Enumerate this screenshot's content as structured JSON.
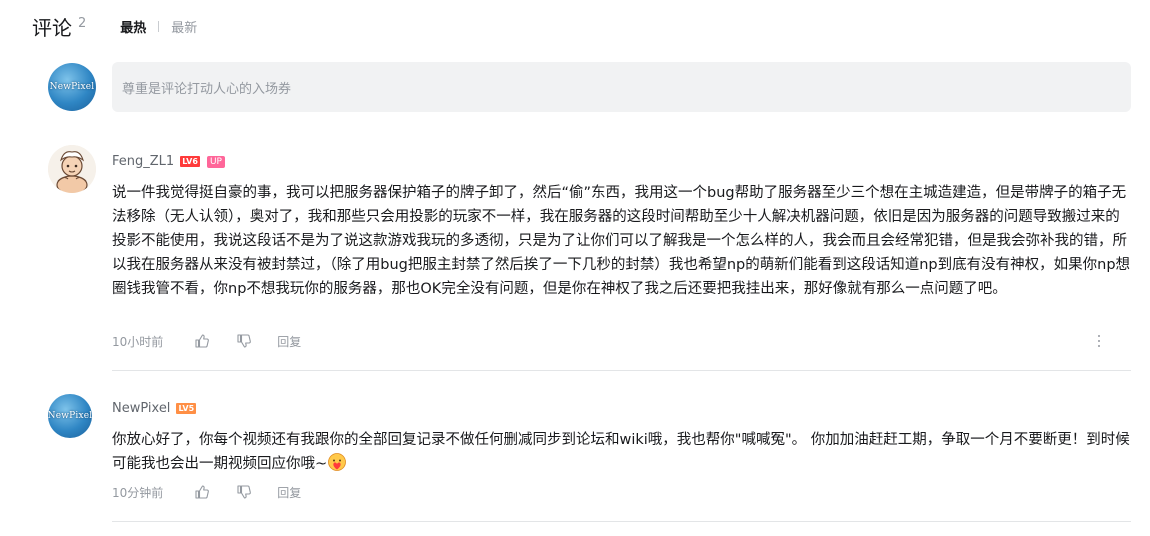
{
  "header": {
    "title": "评论",
    "count": "2",
    "sort_hot": "最热",
    "sort_new": "最新"
  },
  "compose": {
    "placeholder": "尊重是评论打动人心的入场券",
    "avatar_text": "NewPixel"
  },
  "comments": [
    {
      "username": "Feng_ZL1",
      "level": "LV6",
      "badge": "UP",
      "content": "说一件我觉得挺自豪的事，我可以把服务器保护箱子的牌子卸了，然后“偷”东西，我用这一个bug帮助了服务器至少三个想在主城造建造，但是带牌子的箱子无法移除（无人认领），奥对了，我和那些只会用投影的玩家不一样，我在服务器的这段时间帮助至少十人解决机器问题，依旧是因为服务器的问题导致搬过来的投影不能使用，我说这段话不是为了说这款游戏我玩的多透彻，只是为了让你们可以了解我是一个怎么样的人，我会而且会经常犯错，但是我会弥补我的错，所以我在服务器从来没有被封禁过，（除了用bug把服主封禁了然后挨了一下几秒的封禁）我也希望np的萌新们能看到这段话知道np到底有没有神权，如果你np想圈钱我管不看，你np不想我玩你的服务器，那也OK完全没有问题，但是你在神权了我之后还要把我挂出来，那好像就有那么一点问题了吧。",
      "time": "10小时前",
      "reply": "回复"
    },
    {
      "username": "NewPixel",
      "level": "LV5",
      "avatar_text": "NewPixel",
      "content": "你放心好了，你每个视频还有我跟你的全部回复记录不做任何删减同步到论坛和wiki哦，我也帮你\"喊喊冤\"。 你加加油赶赶工期，争取一个月不要断更！到时候可能我也会出一期视频回应你哦~",
      "time": "10分钟前",
      "reply": "回复"
    }
  ],
  "colors": {
    "lv6": "#ff3a3a",
    "lv5": "#ff8f45",
    "up_badge": "#ff6699",
    "muted": "#9499a0"
  }
}
